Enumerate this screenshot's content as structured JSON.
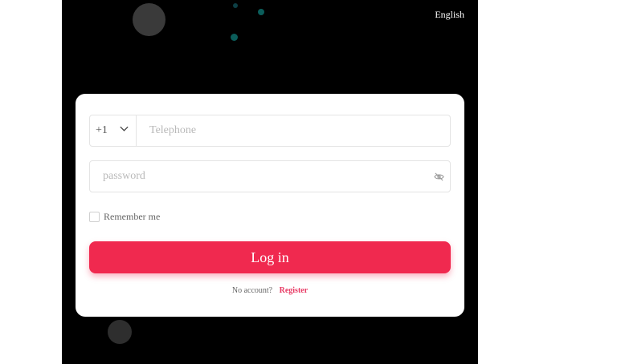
{
  "header": {
    "language": "English"
  },
  "login_form": {
    "country_code": "+1",
    "telephone_placeholder": "Telephone",
    "telephone_value": "",
    "password_placeholder": "password",
    "password_value": "",
    "remember_label": "Remember me",
    "remember_checked": false,
    "login_button": "Log in",
    "no_account_text": "No account?",
    "register_link": "Register"
  },
  "colors": {
    "background": "#000000",
    "card": "#ffffff",
    "accent": "#f0294f",
    "register_link": "#e83a64"
  }
}
